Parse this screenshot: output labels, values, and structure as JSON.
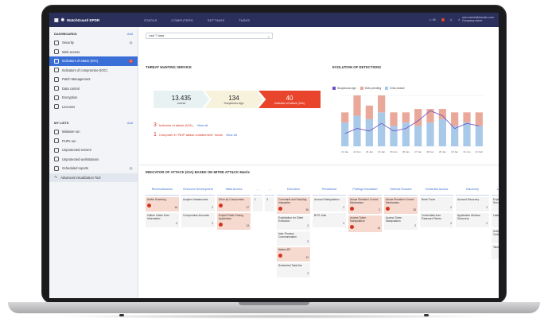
{
  "app": {
    "title": "WatchGuard EPDR"
  },
  "topbar": {
    "tabs": [
      "STATUS",
      "COMPUTERS",
      "SETTINGS",
      "TASKS"
    ],
    "notif_count": "48",
    "user_email": "user.name@domain.com",
    "company": "Company name"
  },
  "sidebar": {
    "dashboards_label": "DASHBOARDS",
    "add_label": "Add",
    "items": [
      {
        "label": "Security",
        "count": "2"
      },
      {
        "label": "Web access",
        "count": ""
      },
      {
        "label": "Indicators of attack (IOA)",
        "count": "3"
      },
      {
        "label": "Indicators of compromise (IOC)",
        "count": ""
      },
      {
        "label": "Patch Management",
        "count": ""
      },
      {
        "label": "Data control",
        "count": ""
      },
      {
        "label": "Encryption",
        "count": ""
      },
      {
        "label": "Licenses",
        "count": ""
      }
    ],
    "mylists_label": "MY LISTS",
    "list_add_label": "Add",
    "lists": [
      {
        "label": "Malware run",
        "count": ""
      },
      {
        "label": "PUPs run",
        "count": ""
      },
      {
        "label": "Unprotected servers",
        "count": ""
      },
      {
        "label": "Unprotected workstations",
        "count": ""
      },
      {
        "label": "Scheduled reports",
        "count": "2"
      },
      {
        "label": "Advanced visualization Tool",
        "count": ""
      }
    ]
  },
  "main": {
    "period": "Last 7 days",
    "threat_title": "THREAT HUNTING SERVICE",
    "funnel": [
      {
        "value": "13.435",
        "label": "events"
      },
      {
        "value": "134",
        "label": "Suspicious sign"
      },
      {
        "value": "40",
        "label": "Indicator of attack (IOA)"
      }
    ],
    "alert1": {
      "n": "3",
      "text": "Indicator of attack (IOA) -",
      "link": "View all"
    },
    "alert2": {
      "n": "1",
      "text": "Computer in \"RDP attack containment\" mode.",
      "link": "View all"
    },
    "evolution_title": "EVOLUTION OF DETECTIONS",
    "matrix_title": "INDICATOR OF ATTACK (IOA) BASED ON MITRE ATT&CK Matrix"
  },
  "chart_data": {
    "type": "bar",
    "series": [
      {
        "name": "Suspicious sign",
        "color": "#6b4fc6"
      },
      {
        "name": "IOAs pending",
        "color": "#e9a89a"
      },
      {
        "name": "IOAs closed",
        "color": "#a9c9e8"
      }
    ],
    "categories": [
      "21 Jan",
      "22 Jan",
      "23 Jan",
      "24 Jan",
      "25 Jan",
      "26 Jan",
      "27 Jan",
      "28 Jan",
      "29 Jan",
      "30 Jan",
      "31 Jan",
      "01 Feb"
    ],
    "pending": [
      3,
      6,
      4,
      5,
      4,
      3,
      5,
      4,
      3,
      4,
      3,
      4
    ],
    "closed": [
      7,
      9,
      8,
      10,
      6,
      7,
      6,
      7,
      8,
      6,
      7,
      6
    ],
    "line": [
      5,
      7,
      6,
      9,
      6,
      7,
      10,
      14,
      12,
      7,
      9,
      8
    ],
    "ylim": [
      0,
      15
    ],
    "y2lim": [
      0,
      20
    ]
  },
  "matrix": [
    {
      "header": "Reconnaissance",
      "cells": [
        {
          "text": "Active Scanning",
          "count": "16",
          "red": true
        },
        {
          "text": "Gather Victim Host Information",
          "count": "3",
          "red": false
        }
      ]
    },
    {
      "header": "Resource Development",
      "cells": [
        {
          "text": "Acquire Infrastructure",
          "count": "2",
          "red": false
        },
        {
          "text": "Compromise Accounts",
          "count": "2",
          "red": false
        }
      ]
    },
    {
      "header": "Initial Access",
      "cells": [
        {
          "text": "Drive-by Compromise",
          "count": "17",
          "red": true
        },
        {
          "text": "Exploit Public-Facing Application",
          "count": "13",
          "red": true
        }
      ]
    },
    {
      "header": "...",
      "narrow": true,
      "cells": [
        {
          "text": "1",
          "count": "",
          "red": false
        }
      ]
    },
    {
      "header": "...",
      "narrow": true,
      "cells": [
        {
          "text": "3",
          "count": "",
          "red": false
        }
      ]
    },
    {
      "header": "Execution",
      "cells": [
        {
          "text": "Command and Scripting Interpreter",
          "count": "36",
          "red": true
        },
        {
          "text": "Exploitation for Client Execution",
          "count": "3",
          "red": false
        },
        {
          "text": "Inter-Process Communication",
          "count": "3",
          "red": false
        },
        {
          "text": "Native API",
          "count": "12",
          "red": true
        },
        {
          "text": "Scheduled Task/Job",
          "count": "3",
          "red": false
        }
      ]
    },
    {
      "header": "Persistence",
      "cells": [
        {
          "text": "Account Manipulation",
          "count": "2",
          "red": false
        },
        {
          "text": "BITS Jobs",
          "count": "2",
          "red": false
        }
      ]
    },
    {
      "header": "Privilege Escalation",
      "cells": [
        {
          "text": "Abuse Elevation Control Mechanism",
          "count": "2",
          "red": true
        },
        {
          "text": "Access Token Manipulation",
          "count": "13",
          "red": true
        }
      ]
    },
    {
      "header": "Defense Evasion",
      "cells": [
        {
          "text": "Abuse Elevation Control Mechanism",
          "count": "33",
          "red": true
        },
        {
          "text": "Access Token Manipulation",
          "count": "2",
          "red": false
        }
      ]
    },
    {
      "header": "Credential Access",
      "cells": [
        {
          "text": "Brute Force",
          "count": "2",
          "red": false
        },
        {
          "text": "Credentials from Password Stores",
          "count": "2",
          "red": false
        }
      ]
    },
    {
      "header": "Discovery",
      "cells": [
        {
          "text": "Account Discovery",
          "count": "2",
          "red": false
        },
        {
          "text": "Application Window Discovery",
          "count": "2",
          "red": false
        }
      ]
    },
    {
      "header": "Lateral Movement",
      "cells": [
        {
          "text": "Exploitation of Remote Services",
          "count": "2",
          "red": false
        },
        {
          "text": "Lateral Tool Transfer",
          "count": "2",
          "red": false
        },
        {
          "text": "Software Deployment Tools",
          "count": "2",
          "red": false
        },
        {
          "text": "Taint Shared Content",
          "count": "2",
          "red": false
        }
      ]
    },
    {
      "header": "Coll",
      "cells": [
        {
          "text": "Tech",
          "count": "2",
          "red": false
        },
        {
          "text": "Tech",
          "count": "2",
          "red": false
        }
      ]
    }
  ]
}
